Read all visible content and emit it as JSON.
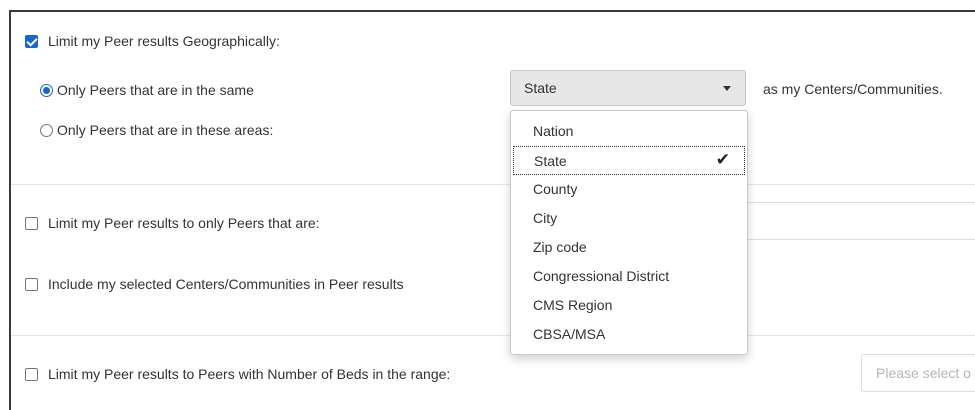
{
  "geo": {
    "checkbox_label": "Limit my Peer results Geographically:",
    "checked": true,
    "radio_same_label": "Only Peers that are in the same",
    "radio_areas_label": "Only Peers that are in these areas:",
    "select_value": "State",
    "as_my_label": "as my Centers/Communities."
  },
  "dropdown": {
    "options": [
      "Nation",
      "State",
      "County",
      "City",
      "Zip code",
      "Congressional District",
      "CMS Region",
      "CBSA/MSA"
    ],
    "selected": "State",
    "check_glyph": "✔"
  },
  "peer_type": {
    "checkbox_label": "Limit my Peer results to only Peers that are:",
    "checked": false
  },
  "include": {
    "checkbox_label": "Include my selected Centers/Communities in Peer results",
    "checked": false
  },
  "beds": {
    "checkbox_label": "Limit my Peer results to Peers with Number of Beds in the range:",
    "checked": false,
    "placeholder": "Please select o"
  }
}
